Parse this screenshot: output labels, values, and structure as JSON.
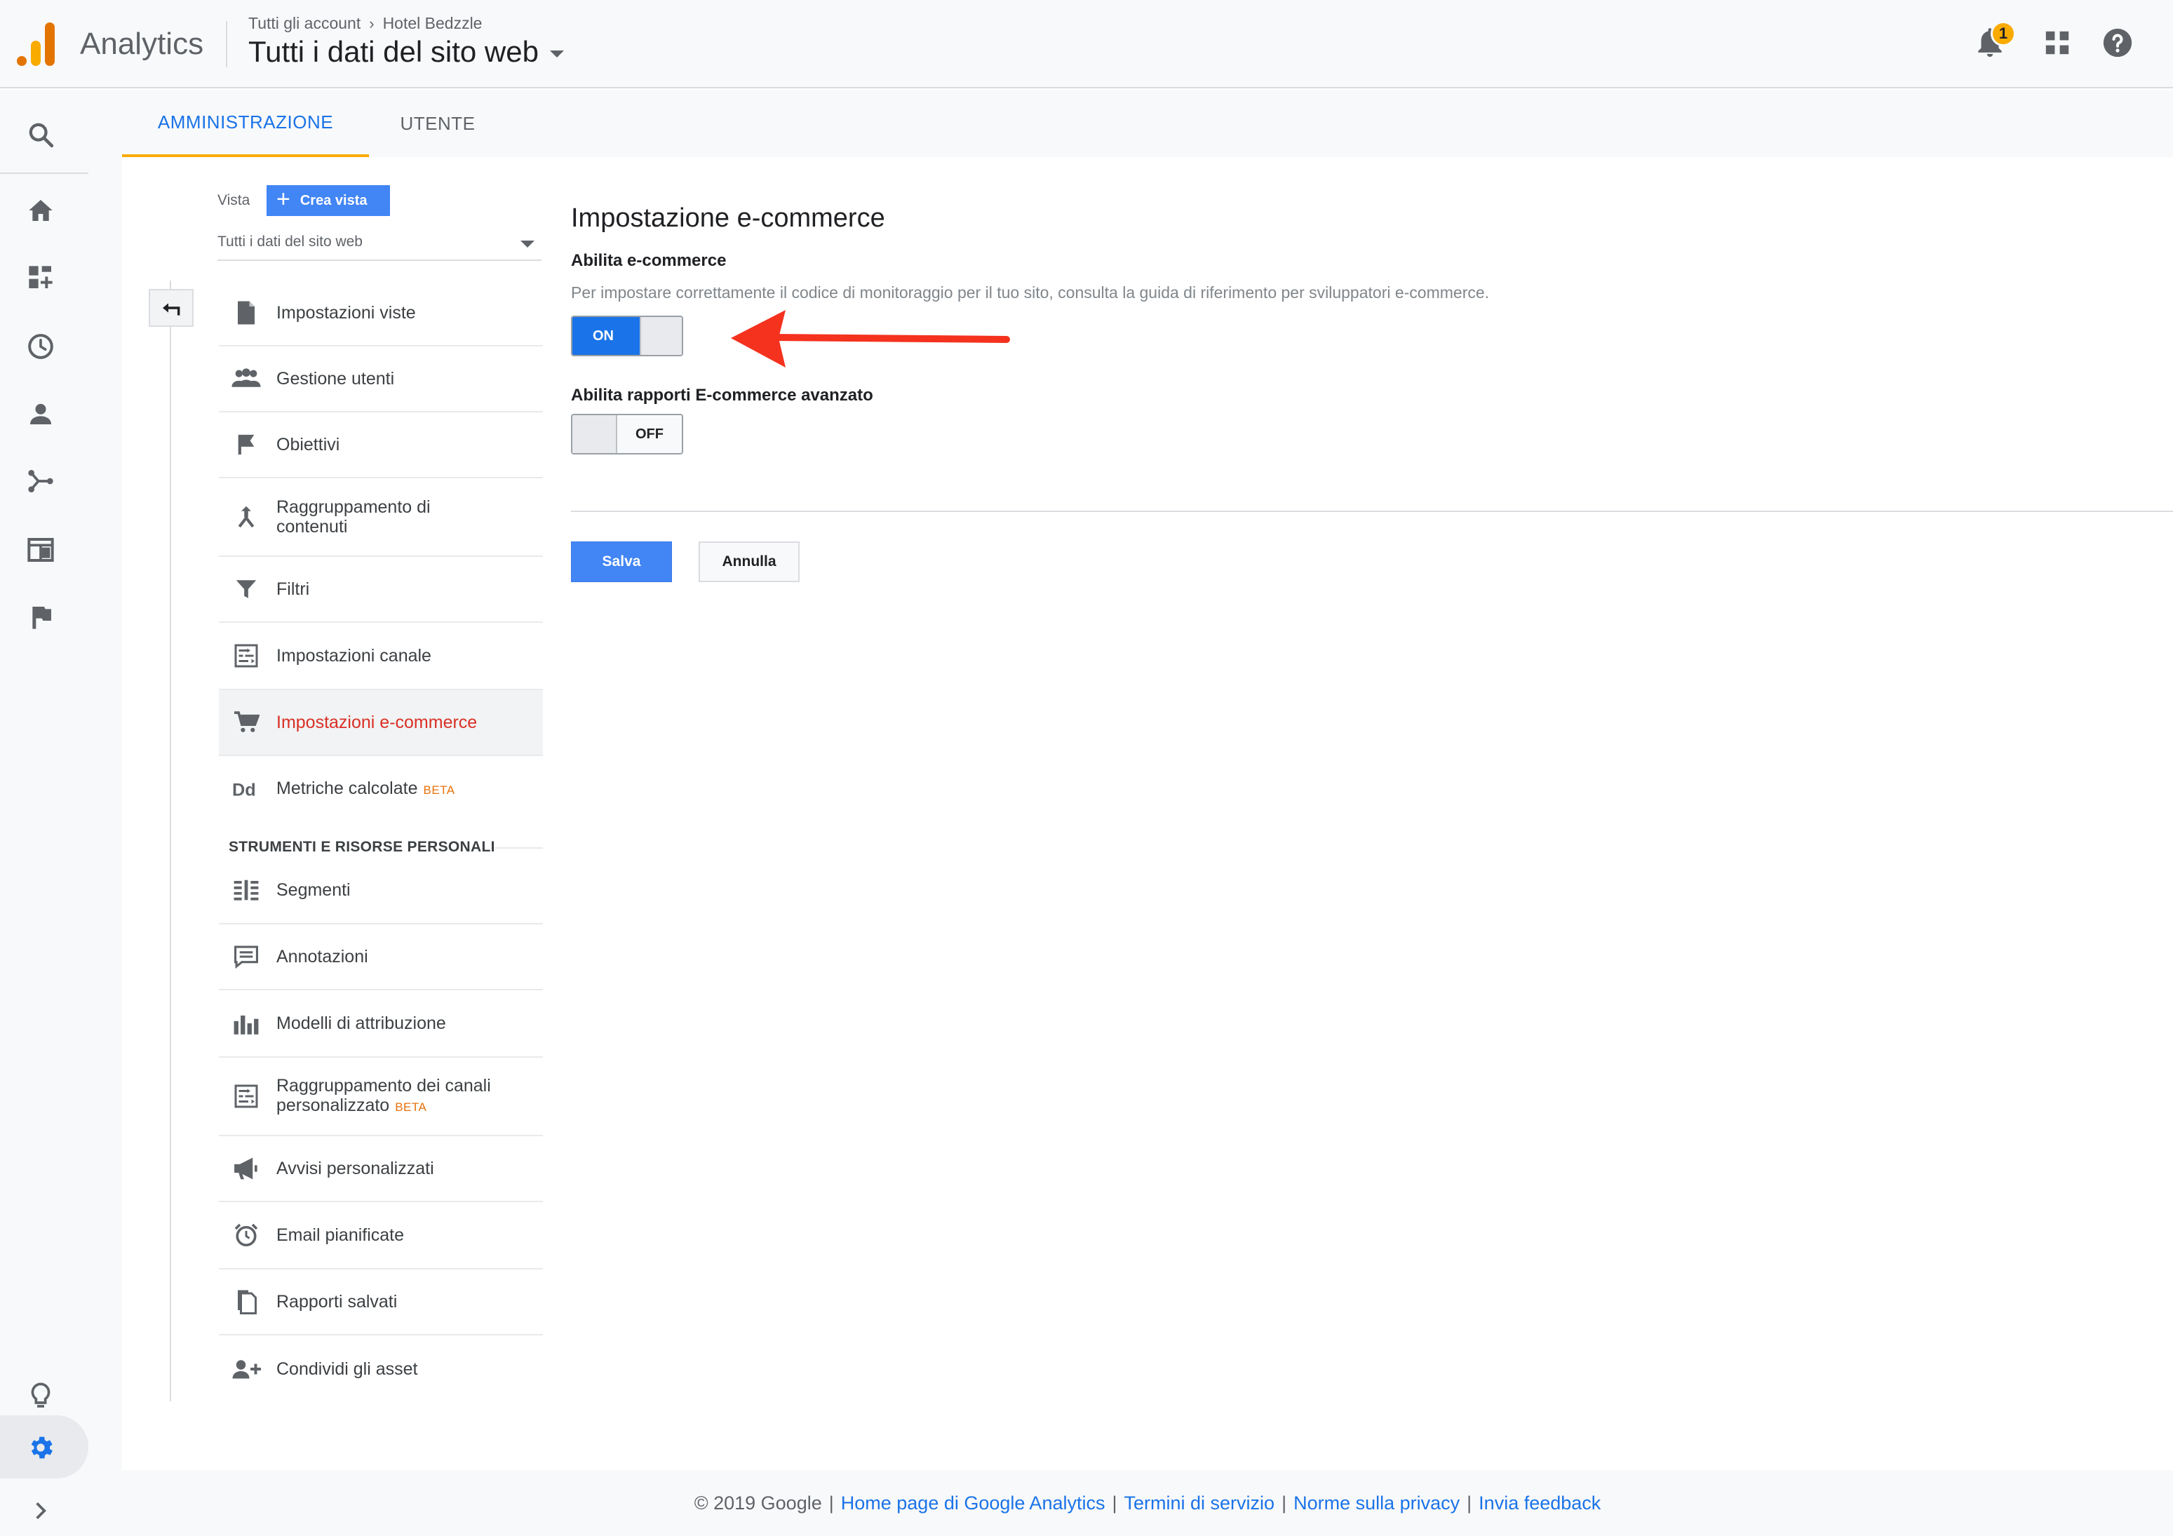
{
  "header": {
    "product_name": "Analytics",
    "breadcrumb": {
      "account_root": "Tutti gli account",
      "account": "Hotel Bedzzle"
    },
    "property_title": "Tutti i dati del sito web",
    "notification_count": "1",
    "icons": [
      "bell-icon",
      "apps-grid-icon",
      "help-icon",
      "more-vert-icon"
    ]
  },
  "rail": {
    "icons": [
      "search-icon",
      "home-icon",
      "customization-icon",
      "realtime-clock-icon",
      "audience-person-icon",
      "acquisition-icon",
      "behavior-icon",
      "conversions-flag-icon",
      "lightbulb-icon",
      "gear-icon",
      "expand-chevron-icon"
    ],
    "active": "gear-icon"
  },
  "tabs": [
    {
      "label": "AMMINISTRAZIONE",
      "active": true
    },
    {
      "label": "UTENTE",
      "active": false
    }
  ],
  "view": {
    "label": "Vista",
    "create_button": "Crea vista",
    "selected": "Tutti i dati del sito web"
  },
  "menu": {
    "items": [
      {
        "label": "Impostazioni viste",
        "icon": "document-icon"
      },
      {
        "label": "Gestione utenti",
        "icon": "people-icon"
      },
      {
        "label": "Obiettivi",
        "icon": "flag-icon"
      },
      {
        "label": "Raggruppamento di contenuti",
        "icon": "content-grouping-icon"
      },
      {
        "label": "Filtri",
        "icon": "filter-icon"
      },
      {
        "label": "Impostazioni canale",
        "icon": "channel-settings-icon"
      },
      {
        "label": "Impostazioni e-commerce",
        "icon": "cart-icon",
        "active": true
      },
      {
        "label": "Metriche calcolate",
        "icon": "calculated-metrics-icon",
        "badge": "BETA"
      }
    ],
    "section_title": "STRUMENTI E RISORSE PERSONALI",
    "personal_items": [
      {
        "label": "Segmenti",
        "icon": "segments-icon"
      },
      {
        "label": "Annotazioni",
        "icon": "annotations-icon"
      },
      {
        "label": "Modelli di attribuzione",
        "icon": "attribution-chart-icon"
      },
      {
        "label": "Raggruppamento dei canali personalizzato",
        "icon": "custom-channel-icon",
        "badge": "BETA"
      },
      {
        "label": "Avvisi personalizzati",
        "icon": "megaphone-icon"
      },
      {
        "label": "Email pianificate",
        "icon": "alarm-clock-icon"
      },
      {
        "label": "Rapporti salvati",
        "icon": "saved-reports-icon"
      },
      {
        "label": "Condividi gli asset",
        "icon": "share-person-icon"
      }
    ]
  },
  "settings": {
    "title": "Impostazione e-commerce",
    "enable_ecommerce_label": "Abilita e-commerce",
    "help_text": "Per impostare correttamente il codice di monitoraggio per il tuo sito, consulta la guida di riferimento per sviluppatori e-commerce.",
    "toggle_on_label": "ON",
    "enhanced_label": "Abilita rapporti E-commerce avanzato",
    "toggle_off_label": "OFF",
    "ecommerce_enabled": true,
    "enhanced_enabled": false,
    "save_button": "Salva",
    "cancel_button": "Annulla",
    "annotation_arrow_color": "#f4321e"
  },
  "footer": {
    "copyright": "© 2019 Google",
    "links": [
      "Home page di Google Analytics",
      "Termini di servizio",
      "Norme sulla privacy",
      "Invia feedback"
    ]
  },
  "colors": {
    "accent": "#1a73e8",
    "active_tab_underline": "#f9ab00",
    "active_menu_text": "#d93025",
    "beta": "#e8710a"
  }
}
